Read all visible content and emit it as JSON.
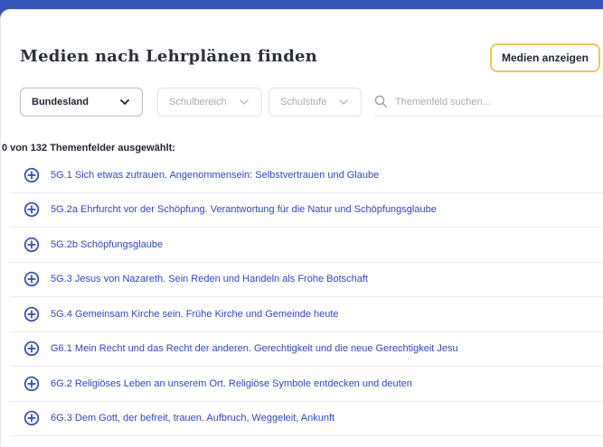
{
  "header": {
    "title": "Medien nach Lehrplänen finden",
    "show_button": "Medien anzeigen"
  },
  "filters": {
    "bundesland": "Bundesland",
    "schulbereich": "Schulbereich",
    "schulstufe": "Schulstufe",
    "search_placeholder": "Themenfeld suchen..."
  },
  "selection_count": "0 von 132 Themenfelder ausgewählt:",
  "topics": [
    "5G.1 Sich etwas zutrauen. Angenommensein: Selbstvertrauen und Glaube",
    "5G.2a Ehrfurcht vor der Schöpfung. Verantwortung für die Natur und Schöpfungsglaube",
    "5G.2b Schöpfungsglaube",
    "5G.3 Jesus von Nazareth. Sein Reden und Handeln als Frohe Botschaft",
    "5G.4 Gemeinsam Kirche sein. Frühe Kirche und Gemeinde heute",
    "G6.1 Mein Recht und das Recht der anderen. Gerechtigkeit und die neue Gerechtigkeit Jesu",
    "6G.2 Religiöses Leben an unserem Ort. Religiöse Symbole entdecken und deuten",
    "6G.3 Dem Gott, der befreit, trauen. Aufbruch, Weggeleit, Ankunft"
  ],
  "colors": {
    "background": "#3553b8",
    "accent_border": "#f2c45b",
    "link": "#2f47c3"
  },
  "icons": {
    "add": "plus-circle-icon",
    "search": "search-icon",
    "dropdown": "chevron-down-icon"
  }
}
